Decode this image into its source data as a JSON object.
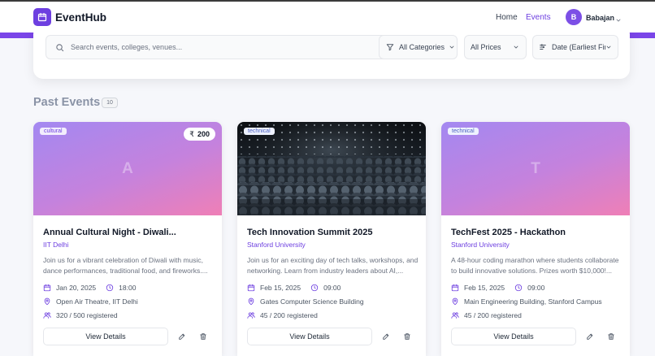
{
  "header": {
    "brand": "EventHub",
    "nav": [
      {
        "label": "Home",
        "active": false
      },
      {
        "label": "Events",
        "active": true
      }
    ],
    "user": {
      "initial": "B",
      "name": "Babajan"
    }
  },
  "filters": {
    "search_placeholder": "Search events, colleges, venues...",
    "category": "All Categories",
    "price": "All Prices",
    "sort": "Date (Earliest First)"
  },
  "section": {
    "title": "Past Events",
    "count": "10"
  },
  "events": [
    {
      "category": "cultural",
      "price": "200",
      "placeholder_letter": "A",
      "title": "Annual Cultural Night - Diwali...",
      "organizer": "IIT Delhi",
      "description": "Join us for a vibrant celebration of Diwali with music, dance performances, traditional food, and fireworks....",
      "date": "Jan 20, 2025",
      "time": "18:00",
      "venue": "Open Air Theatre, IIT Delhi",
      "registered": "320 / 500 registered",
      "button_label": "View Details"
    },
    {
      "category": "technical",
      "price": "",
      "placeholder_letter": "",
      "title": "Tech Innovation Summit 2025",
      "organizer": "Stanford University",
      "description": "Join us for an exciting day of tech talks, workshops, and networking. Learn from industry leaders about AI,...",
      "date": "Feb 15, 2025",
      "time": "09:00",
      "venue": "Gates Computer Science Building",
      "registered": "45 / 200 registered",
      "button_label": "View Details"
    },
    {
      "category": "technical",
      "price": "",
      "placeholder_letter": "T",
      "title": "TechFest 2025 - Hackathon",
      "organizer": "Stanford University",
      "description": "A 48-hour coding marathon where students collaborate to build innovative solutions. Prizes worth $10,000!...",
      "date": "Feb 15, 2025",
      "time": "09:00",
      "venue": "Main Engineering Building, Stanford Campus",
      "registered": "45 / 200 registered",
      "button_label": "View Details"
    }
  ],
  "colors": {
    "accent": "#6d3fe0",
    "gradient_start": "#a388f1",
    "gradient_end": "#ef7fb6"
  }
}
